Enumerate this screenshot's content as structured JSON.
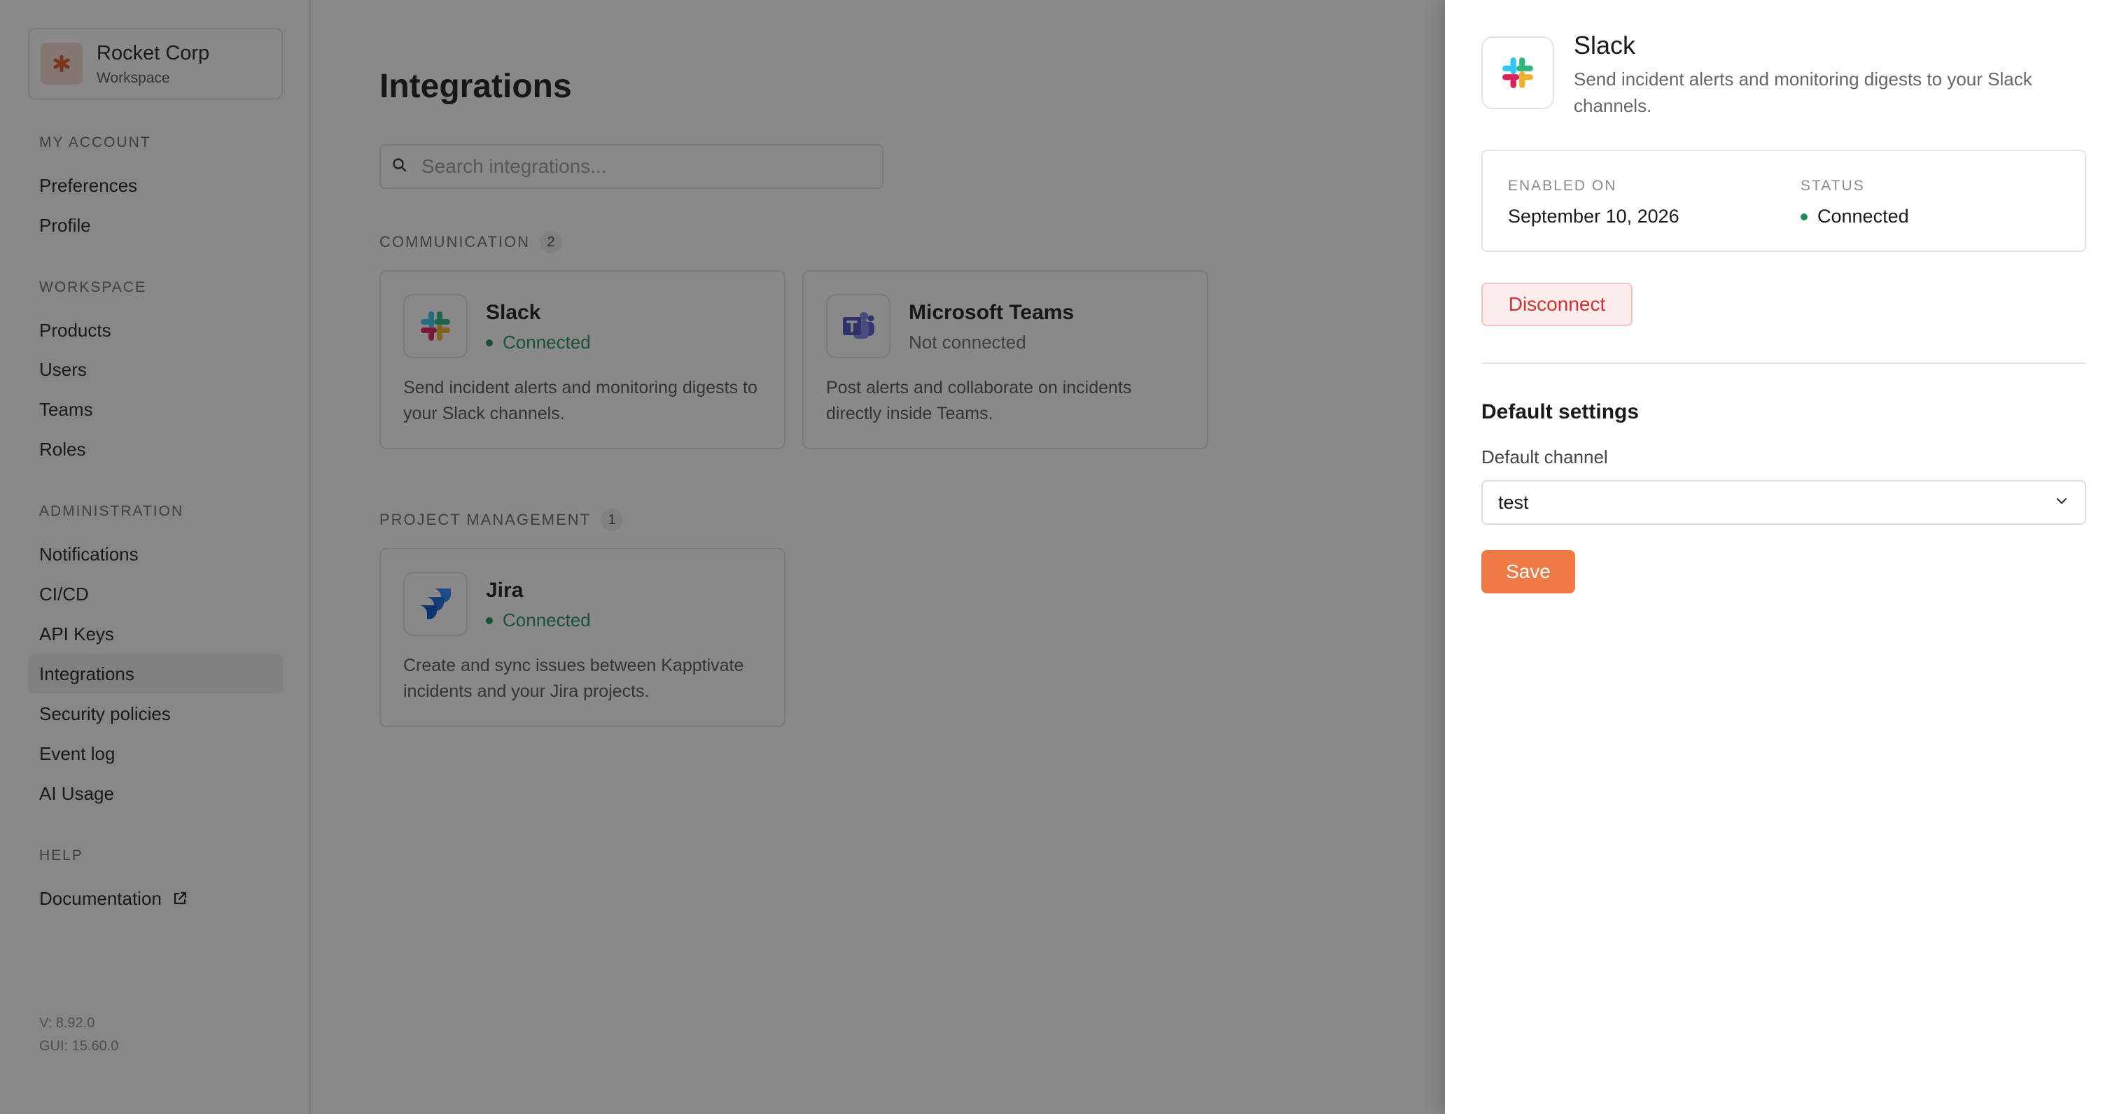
{
  "workspace": {
    "name": "Rocket Corp",
    "subtitle": "Workspace",
    "logo_icon": "asterisk-icon",
    "logo_color": "#e2572b"
  },
  "sidebar": {
    "sections": [
      {
        "title": "MY ACCOUNT",
        "items": [
          {
            "label": "Preferences"
          },
          {
            "label": "Profile"
          }
        ]
      },
      {
        "title": "WORKSPACE",
        "items": [
          {
            "label": "Products"
          },
          {
            "label": "Users"
          },
          {
            "label": "Teams"
          },
          {
            "label": "Roles"
          }
        ]
      },
      {
        "title": "ADMINISTRATION",
        "items": [
          {
            "label": "Notifications"
          },
          {
            "label": "CI/CD"
          },
          {
            "label": "API Keys"
          },
          {
            "label": "Integrations",
            "active": true
          },
          {
            "label": "Security policies"
          },
          {
            "label": "Event log"
          },
          {
            "label": "AI Usage"
          }
        ]
      },
      {
        "title": "HELP",
        "items": [
          {
            "label": "Documentation",
            "icon": "external-link-icon"
          }
        ]
      }
    ],
    "version": "V: 8.92.0",
    "gui_version": "GUI: 15.60.0"
  },
  "main": {
    "title": "Integrations",
    "search": {
      "placeholder": "Search integrations...",
      "value": ""
    },
    "groups": [
      {
        "label": "COMMUNICATION",
        "count": "2",
        "cards": [
          {
            "name": "Slack",
            "icon": "slack-logo-icon",
            "status": "Connected",
            "connected": true,
            "description": "Send incident alerts and monitoring digests to your Slack channels."
          },
          {
            "name": "Microsoft Teams",
            "icon": "teams-logo-icon",
            "status": "Not connected",
            "connected": false,
            "description": "Post alerts and collaborate on incidents directly inside Teams."
          }
        ]
      },
      {
        "label": "PROJECT MANAGEMENT",
        "count": "1",
        "cards": [
          {
            "name": "Jira",
            "icon": "jira-logo-icon",
            "status": "Connected",
            "connected": true,
            "description": "Create and sync issues between Kapptivate incidents and your Jira projects."
          }
        ]
      }
    ]
  },
  "drawer": {
    "title": "Slack",
    "icon": "slack-logo-icon",
    "description": "Send incident alerts and monitoring digests to your Slack channels.",
    "enabled_on_label": "ENABLED ON",
    "enabled_on_value": "September 10, 2026",
    "status_label": "STATUS",
    "status_value": "Connected",
    "disconnect_label": "Disconnect",
    "settings_title": "Default settings",
    "channel_label": "Default channel",
    "channel_value": "test",
    "save_label": "Save"
  },
  "colors": {
    "accent": "#ef7a45",
    "connected": "#1f8f55",
    "danger": "#d0322e",
    "overlay": "rgba(20,20,20,0.5)"
  }
}
